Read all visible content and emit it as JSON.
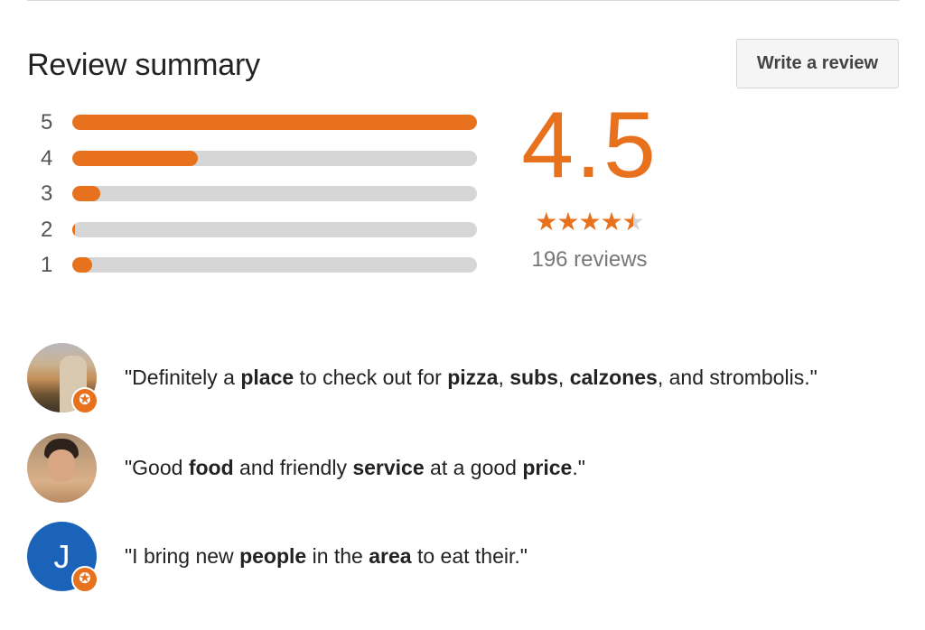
{
  "header": {
    "title": "Review summary",
    "write_review_label": "Write a review"
  },
  "histogram": [
    {
      "stars": "5",
      "fraction": 1.0
    },
    {
      "stars": "4",
      "fraction": 0.31
    },
    {
      "stars": "3",
      "fraction": 0.07
    },
    {
      "stars": "2",
      "fraction": 0.005
    },
    {
      "stars": "1",
      "fraction": 0.05
    }
  ],
  "summary": {
    "rating": "4.5",
    "stars_value": 4.5,
    "stars_glyph": "★★★★",
    "half_star_glyph": "★",
    "review_count": "196 reviews"
  },
  "snippets": [
    {
      "avatar": "user-photo",
      "parts": [
        {
          "t": "\"Definitely a "
        },
        {
          "t": "place",
          "b": true
        },
        {
          "t": " to check out for "
        },
        {
          "t": "pizza",
          "b": true
        },
        {
          "t": ", "
        },
        {
          "t": "subs",
          "b": true
        },
        {
          "t": ", "
        },
        {
          "t": "calzones",
          "b": true
        },
        {
          "t": ", and strombolis.\""
        }
      ]
    },
    {
      "avatar": "user-photo",
      "parts": [
        {
          "t": "\"Good "
        },
        {
          "t": "food",
          "b": true
        },
        {
          "t": " and friendly "
        },
        {
          "t": "service",
          "b": true
        },
        {
          "t": " at a good "
        },
        {
          "t": "price",
          "b": true
        },
        {
          "t": ".\""
        }
      ]
    },
    {
      "avatar": "letter",
      "avatar_letter": "J",
      "parts": [
        {
          "t": "\"I bring new "
        },
        {
          "t": "people",
          "b": true
        },
        {
          "t": " in the "
        },
        {
          "t": "area",
          "b": true
        },
        {
          "t": " to eat their.\""
        }
      ]
    }
  ],
  "badge_glyph": "✪",
  "colors": {
    "accent": "#e8711e",
    "track": "#d6d6d6",
    "letter_avatar": "#1b63b8"
  }
}
